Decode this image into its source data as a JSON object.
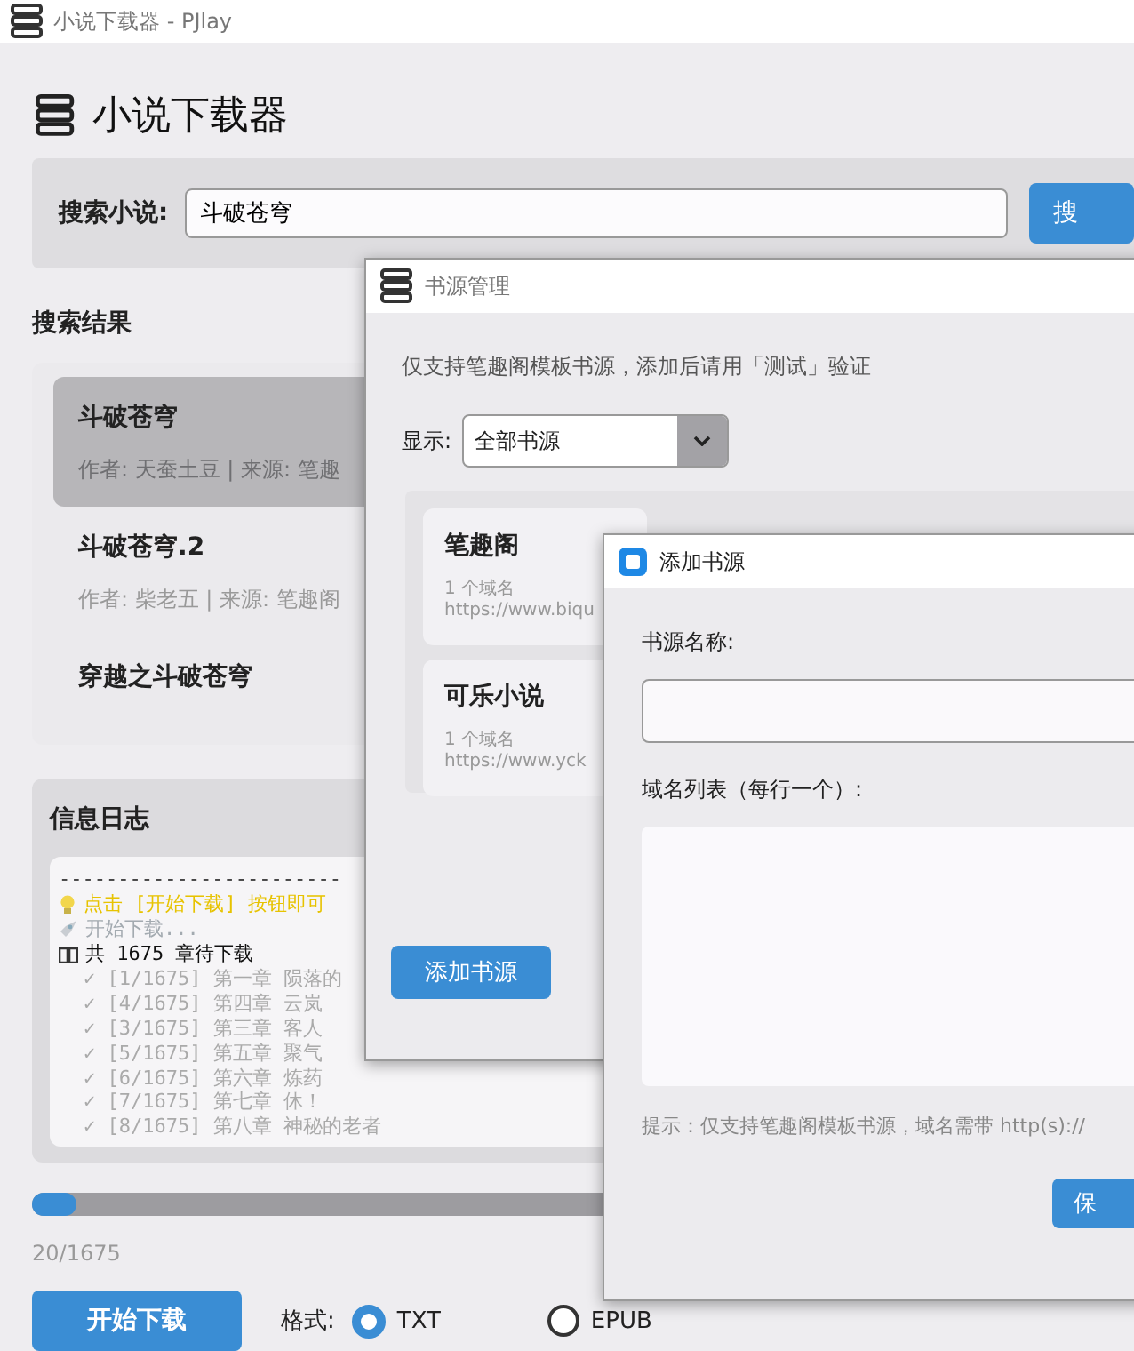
{
  "window": {
    "title": "小说下载器 - PJlay"
  },
  "header": {
    "title": "小说下载器"
  },
  "search": {
    "label": "搜索小说:",
    "value": "斗破苍穹",
    "button": "搜"
  },
  "results": {
    "title": "搜索结果",
    "items": [
      {
        "title": "斗破苍穹",
        "meta": "作者: 天蚕土豆 | 来源: 笔趣",
        "selected": true
      },
      {
        "title": "斗破苍穹.2",
        "meta": "作者: 柴老五 | 来源: 笔趣阁",
        "selected": false
      },
      {
        "title": "穿越之斗破苍穹",
        "selected": false
      }
    ]
  },
  "log": {
    "title": "信息日志",
    "lines": [
      {
        "kind": "rule",
        "text": "------------------------"
      },
      {
        "kind": "tip",
        "text": "点击 [开始下载] 按钮即可"
      },
      {
        "kind": "start",
        "text": "开始下载..."
      },
      {
        "kind": "info",
        "text": "共 1675 章待下载"
      },
      {
        "kind": "done",
        "text": "✓ [1/1675] 第一章 陨落的"
      },
      {
        "kind": "done",
        "text": "✓ [4/1675] 第四章 云岚"
      },
      {
        "kind": "done",
        "text": "✓ [3/1675] 第三章 客人"
      },
      {
        "kind": "done",
        "text": "✓ [5/1675] 第五章 聚气"
      },
      {
        "kind": "done",
        "text": "✓ [6/1675] 第六章 炼药"
      },
      {
        "kind": "done",
        "text": "✓ [7/1675] 第七章 休！"
      },
      {
        "kind": "done",
        "text": "✓ [8/1675] 第八章 神秘的老者"
      }
    ]
  },
  "progress": {
    "level": 0.04,
    "reading": "20/1675"
  },
  "download": {
    "button": "开始下载",
    "format_label": "格式:",
    "formats": [
      {
        "label": "TXT",
        "selected": true
      },
      {
        "label": "EPUB",
        "selected": false
      }
    ]
  },
  "source_dialog": {
    "title": "书源管理",
    "note": "仅支持笔趣阁模板书源，添加后请用「测试」验证",
    "filter_label": "显示:",
    "filter_value": "全部书源",
    "sources": [
      {
        "name": "笔趣阁",
        "count": "1 个域名",
        "url": "https://www.biqu"
      },
      {
        "name": "可乐小说",
        "count": "1 个域名",
        "url": "https://www.yck"
      }
    ],
    "add_button": "添加书源"
  },
  "add_dialog": {
    "title": "添加书源",
    "name_label": "书源名称:",
    "domains_label": "域名列表（每行一个）:",
    "hint": "提示：仅支持笔趣阁模板书源，域名需带 http(s)://",
    "save_button": "保"
  }
}
